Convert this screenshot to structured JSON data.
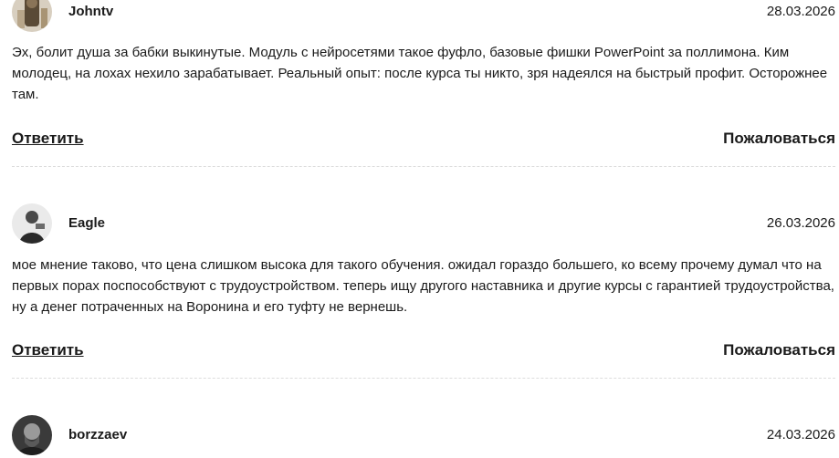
{
  "comments": [
    {
      "author": "Johntv",
      "date": "28.03.2026",
      "text": "Эх, болит душа за бабки выкинутые. Модуль с нейросетями такое фуфло, базовые фишки PowerPoint за поллимона. Ким молодец, на лохах нехило зарабатывает. Реальный опыт: после курса ты никто, зря надеялся на быстрый профит. Осторожнее там.",
      "reply_label": "Ответить",
      "report_label": "Пожаловаться"
    },
    {
      "author": "Eagle",
      "date": "26.03.2026",
      "text": "мое мнение таково, что цена слишком высока для такого обучения. ожидал гораздо большего, ко всему прочему думал что на первых порах поспособствуют с трудоустройством. теперь ищу другого наставника и другие курсы с гарантией трудоустройства, ну а денег потраченных на Воронина и его туфту не вернешь.",
      "reply_label": "Ответить",
      "report_label": "Пожаловаться"
    },
    {
      "author": "borzzaev",
      "date": "24.03.2026"
    }
  ]
}
